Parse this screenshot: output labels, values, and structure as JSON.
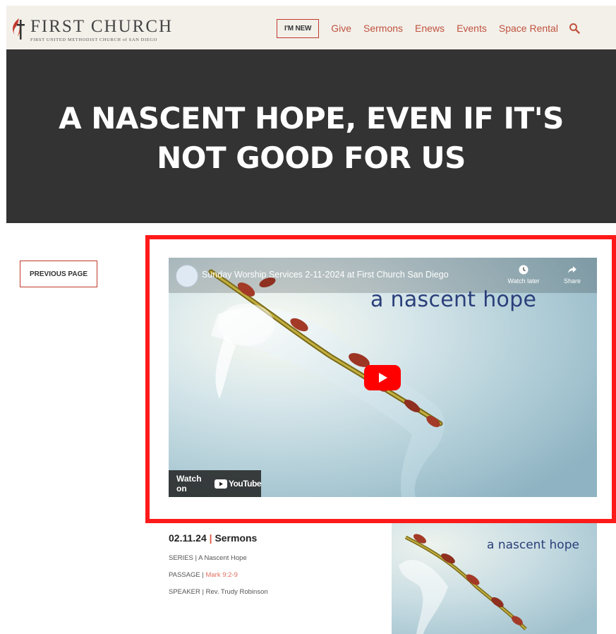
{
  "header": {
    "logo_title": "FIRST CHURCH",
    "logo_subtitle": "FIRST UNITED METHODIST CHURCH of SAN DIEGO",
    "im_new_label": "I'M NEW",
    "nav": [
      "Give",
      "Sermons",
      "Enews",
      "Events",
      "Space Rental"
    ],
    "search_icon": "search-icon"
  },
  "hero": {
    "title_line1": "A NASCENT HOPE, EVEN IF IT'S",
    "title_line2": "NOT GOOD FOR US"
  },
  "previous_page_label": "PREVIOUS PAGE",
  "video": {
    "title": "Sunday Worship Services 2-11-2024 at First Church San Diego",
    "watch_later_label": "Watch later",
    "share_label": "Share",
    "overlay_text": "a nascent hope",
    "watch_on_label": "Watch on",
    "youtube_label": "YouTube"
  },
  "sermon": {
    "date": "02.11.24",
    "separator": "|",
    "category": "Sermons",
    "series_label": "SERIES |",
    "series_value": "A Nascent Hope",
    "passage_label": "PASSAGE |",
    "passage_value": "Mark 9:2-9",
    "speaker_label": "SPEAKER |",
    "speaker_value": "Rev. Trudy Robinson"
  },
  "thumbnail": {
    "overlay_text": "a nascent hope"
  },
  "colors": {
    "accent": "#c0533f",
    "hero_bg": "#333333",
    "highlight_frame": "#ff1a1a",
    "header_bg": "#f3f0ea"
  }
}
